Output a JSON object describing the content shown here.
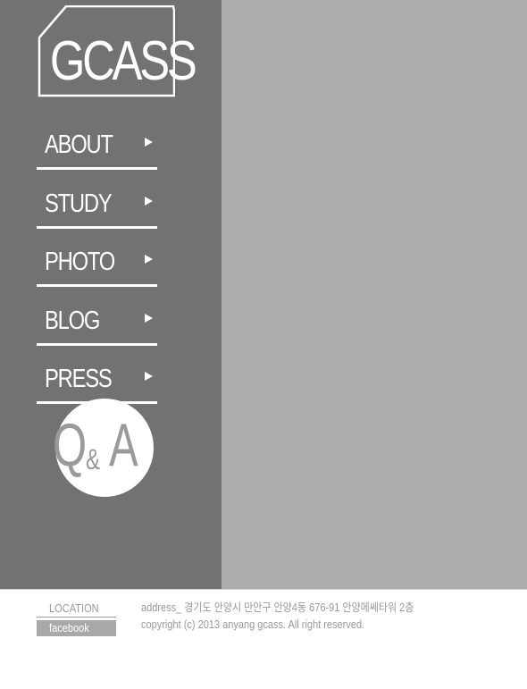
{
  "logo": {
    "text": "GCASS"
  },
  "nav": {
    "items": [
      {
        "label": "ABOUT"
      },
      {
        "label": "STUDY"
      },
      {
        "label": "PHOTO"
      },
      {
        "label": "BLOG"
      },
      {
        "label": "PRESS"
      }
    ]
  },
  "qa": {
    "q": "Q",
    "amp": "&",
    "a": "A"
  },
  "footer": {
    "location": "LOCATION",
    "facebook": "facebook",
    "address": "address_ 경기도 안양시 만안구 안양4동 676-91 안양메쎄타워 2층",
    "copyright": "copyright (c) 2013 anyang gcass. All right reserved."
  },
  "colors": {
    "sidebar": "#727272",
    "main_panel": "#acacac",
    "text_light": "#ffffff",
    "footer_text": "#9a9a9a"
  }
}
